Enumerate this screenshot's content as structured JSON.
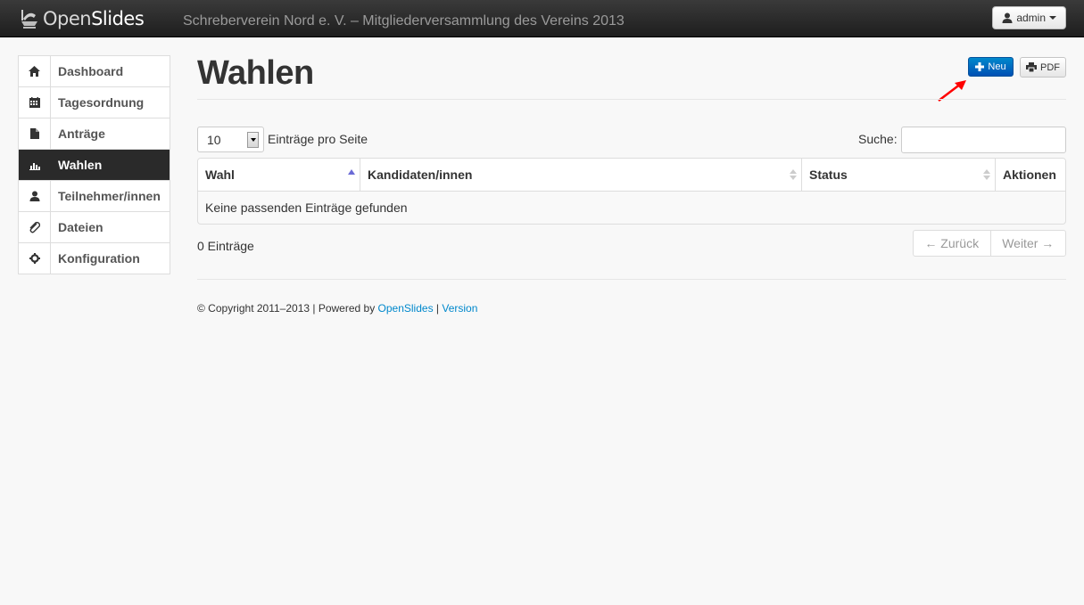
{
  "navbar": {
    "brand_light": "Open",
    "brand_bold": "Slides",
    "event_title": "Schreberverein Nord e. V. – Mitgliederversammlung des Vereins 2013",
    "user_label": "admin"
  },
  "sidebar": {
    "items": [
      {
        "label": "Dashboard",
        "icon": "home-icon"
      },
      {
        "label": "Tagesordnung",
        "icon": "calendar-icon"
      },
      {
        "label": "Anträge",
        "icon": "file-icon"
      },
      {
        "label": "Wahlen",
        "icon": "bar-chart-icon",
        "active": true
      },
      {
        "label": "Teilnehmer/innen",
        "icon": "user-icon"
      },
      {
        "label": "Dateien",
        "icon": "paperclip-icon"
      },
      {
        "label": "Konfiguration",
        "icon": "cog-icon"
      }
    ]
  },
  "main": {
    "title": "Wahlen",
    "new_button": "Neu",
    "pdf_button": "PDF",
    "page_length": "10",
    "page_length_label": "Einträge pro Seite",
    "search_label": "Suche:",
    "search_value": "",
    "columns": [
      "Wahl",
      "Kandidaten/innen",
      "Status",
      "Aktionen"
    ],
    "empty_text": "Keine passenden Einträge gefunden",
    "info_text": "0 Einträge",
    "prev_label": "← Zurück",
    "next_label": "Weiter →"
  },
  "footer": {
    "copyright": "© Copyright 2011–2013 | Powered by ",
    "link_openslides": "OpenSlides",
    "separator": " | ",
    "link_version": "Version"
  },
  "colors": {
    "accent": "#0088cc",
    "navbar": "#2a2a2a",
    "sidebar_active": "#2a2a2a",
    "annotation_arrow": "#ff0000"
  }
}
